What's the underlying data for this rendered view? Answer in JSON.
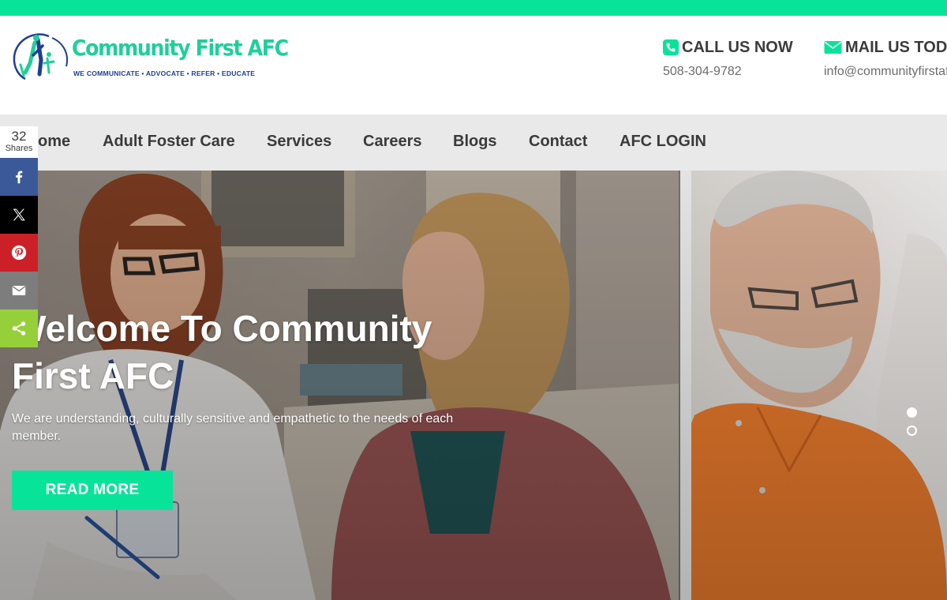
{
  "colors": {
    "accent": "#08e39a",
    "logo_green": "#1fcf9a",
    "logo_blue": "#1c3f91",
    "nav_bg": "#e9e9e9",
    "facebook": "#3b5998",
    "twitter": "#000000",
    "pinterest": "#cb2027",
    "email": "#7d7d7d",
    "sharethis": "#95d03a"
  },
  "header": {
    "logo": {
      "name": "Community First AFC",
      "tagline": "WE COMMUNICATE • ADVOCATE • REFER • EDUCATE",
      "icon": "people-circle-logo-icon"
    },
    "call": {
      "title": "CALL US NOW",
      "value": "508-304-9782",
      "icon": "phone-icon"
    },
    "mail": {
      "title": "MAIL US TOD",
      "value": "info@communityfirstaf",
      "icon": "envelope-icon"
    }
  },
  "nav": {
    "items": [
      {
        "label": "ome"
      },
      {
        "label": "Adult Foster Care"
      },
      {
        "label": "Services"
      },
      {
        "label": "Careers"
      },
      {
        "label": "Blogs"
      },
      {
        "label": "Contact"
      },
      {
        "label": "AFC LOGIN"
      }
    ]
  },
  "hero": {
    "title": "Welcome To Community First AFC",
    "subtitle": "We are understanding, culturally sensitive and empathetic to the needs of each member.",
    "button": "READ MORE",
    "slides": 2,
    "active_slide": 1
  },
  "share": {
    "count": "32",
    "label": "Shares",
    "buttons": [
      {
        "icon": "facebook-icon"
      },
      {
        "icon": "x-icon"
      },
      {
        "icon": "pinterest-icon"
      },
      {
        "icon": "email-icon"
      },
      {
        "icon": "share-icon"
      }
    ]
  }
}
